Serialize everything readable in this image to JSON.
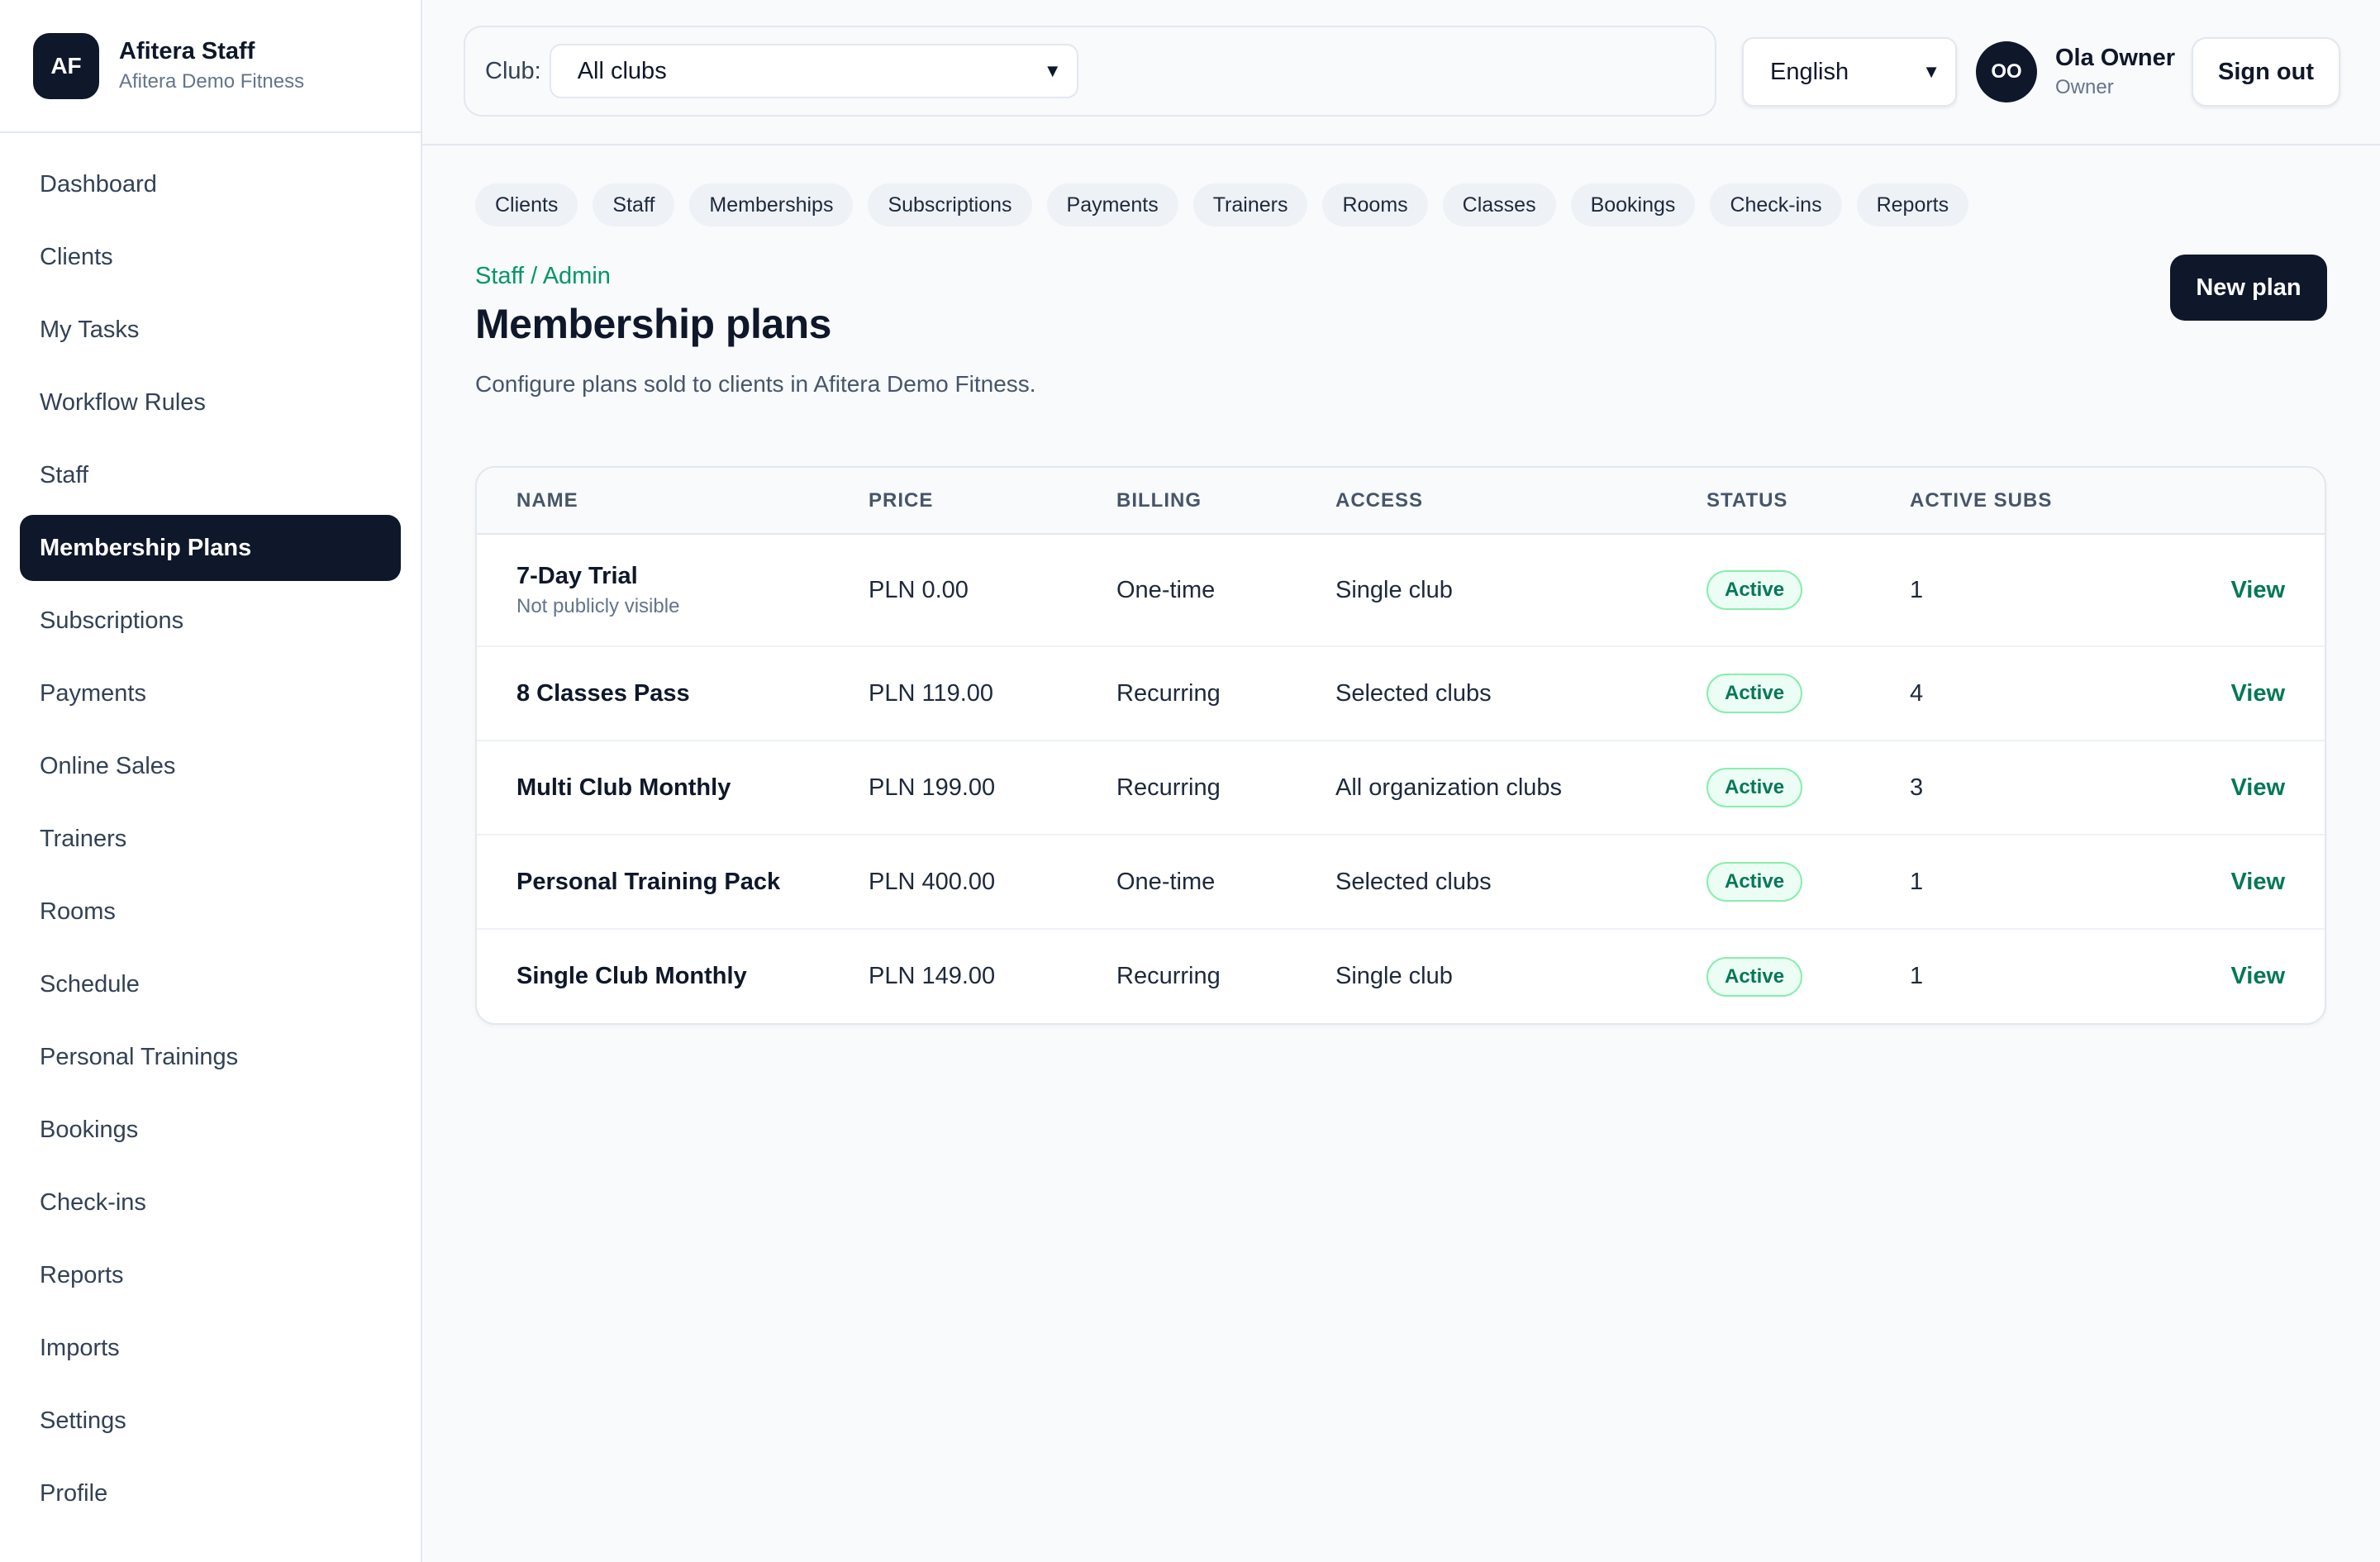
{
  "brand": {
    "initials": "AF",
    "name": "Afitera Staff",
    "org": "Afitera Demo Fitness"
  },
  "sidebar": {
    "items": [
      {
        "label": "Dashboard"
      },
      {
        "label": "Clients"
      },
      {
        "label": "My Tasks"
      },
      {
        "label": "Workflow Rules"
      },
      {
        "label": "Staff"
      },
      {
        "label": "Membership Plans",
        "active": true
      },
      {
        "label": "Subscriptions"
      },
      {
        "label": "Payments"
      },
      {
        "label": "Online Sales"
      },
      {
        "label": "Trainers"
      },
      {
        "label": "Rooms"
      },
      {
        "label": "Schedule"
      },
      {
        "label": "Personal Trainings"
      },
      {
        "label": "Bookings"
      },
      {
        "label": "Check-ins"
      },
      {
        "label": "Reports"
      },
      {
        "label": "Imports"
      },
      {
        "label": "Settings"
      },
      {
        "label": "Profile"
      }
    ]
  },
  "topbar": {
    "club_label": "Club:",
    "club_value": "All clubs",
    "language_value": "English",
    "user_initials": "OO",
    "user_name": "Ola Owner",
    "user_role": "Owner",
    "signout_label": "Sign out"
  },
  "quick_links": [
    "Clients",
    "Staff",
    "Memberships",
    "Subscriptions",
    "Payments",
    "Trainers",
    "Rooms",
    "Classes",
    "Bookings",
    "Check-ins",
    "Reports"
  ],
  "page": {
    "breadcrumb": "Staff / Admin",
    "title": "Membership plans",
    "description": "Configure plans sold to clients in Afitera Demo Fitness.",
    "new_plan_label": "New plan"
  },
  "table": {
    "headers": {
      "name": "NAME",
      "price": "PRICE",
      "billing": "BILLING",
      "access": "ACCESS",
      "status": "STATUS",
      "active_subs": "ACTIVE SUBS"
    },
    "rows": [
      {
        "name": "7-Day Trial",
        "note": "Not publicly visible",
        "price": "PLN 0.00",
        "billing": "One-time",
        "access": "Single club",
        "status": "Active",
        "active_subs": "1",
        "action": "View"
      },
      {
        "name": "8 Classes Pass",
        "price": "PLN 119.00",
        "billing": "Recurring",
        "access": "Selected clubs",
        "status": "Active",
        "active_subs": "4",
        "action": "View"
      },
      {
        "name": "Multi Club Monthly",
        "price": "PLN 199.00",
        "billing": "Recurring",
        "access": "All organization clubs",
        "status": "Active",
        "active_subs": "3",
        "action": "View"
      },
      {
        "name": "Personal Training Pack",
        "price": "PLN 400.00",
        "billing": "One-time",
        "access": "Selected clubs",
        "status": "Active",
        "active_subs": "1",
        "action": "View"
      },
      {
        "name": "Single Club Monthly",
        "price": "PLN 149.00",
        "billing": "Recurring",
        "access": "Single club",
        "status": "Active",
        "active_subs": "1",
        "action": "View"
      }
    ]
  },
  "colors": {
    "primary": "#0f172a",
    "accent": "#059669",
    "status_active": "#047857"
  },
  "icons": {
    "select_chevron": "chevron-down-icon"
  }
}
